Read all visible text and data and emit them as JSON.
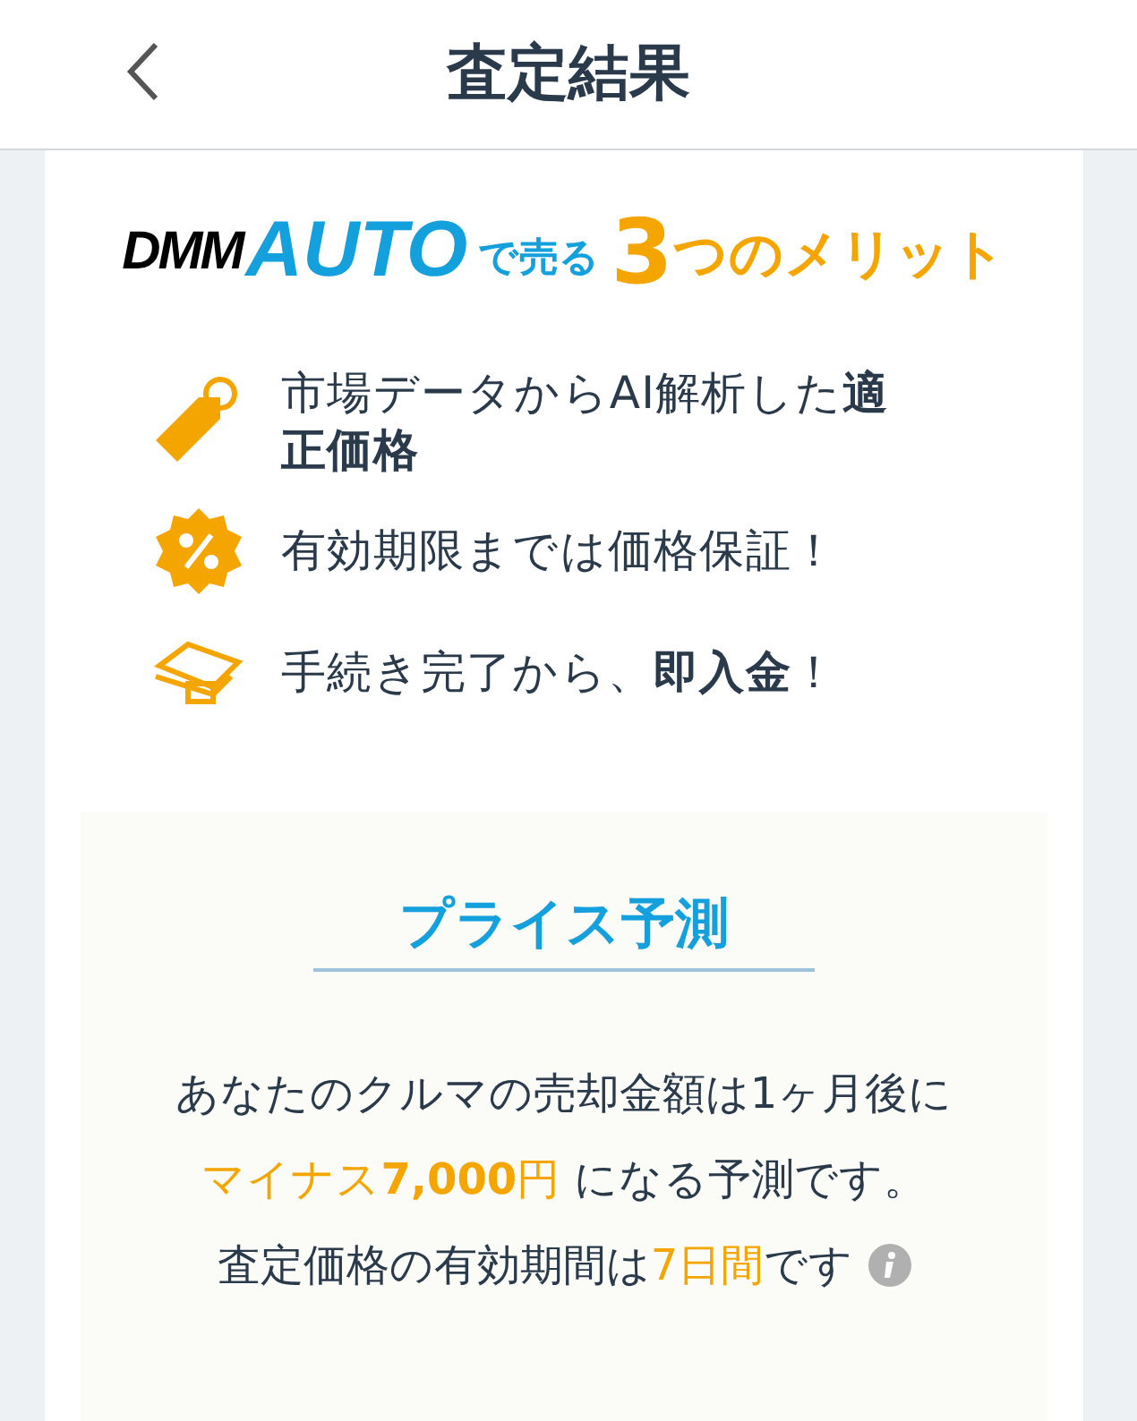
{
  "header": {
    "title": "査定結果"
  },
  "logo": {
    "brand": "DMM",
    "product": "AUTO",
    "suffix": "で売る",
    "number": "3",
    "tail": "つのメリット"
  },
  "merits": [
    {
      "kind": "tag",
      "text": "市場データからAI解析した**適正価格**"
    },
    {
      "kind": "percent",
      "text": "有効期限までは価格保証！"
    },
    {
      "kind": "money",
      "text": "手続き完了から、**即入金**！"
    }
  ],
  "prediction": {
    "title": "プライス予測",
    "lines": [
      [
        {
          "text": "あなたのクルマの売却金額は1ヶ月後に",
          "accent": false
        }
      ],
      [
        {
          "text": "マイナス**7,000**円",
          "accent": true
        },
        {
          "text": " になる予測です。",
          "accent": false
        }
      ],
      [
        {
          "text": "査定価格の有効期間は",
          "accent": false
        },
        {
          "text": "7日間",
          "accent": true
        },
        {
          "text": "です",
          "accent": false
        }
      ]
    ]
  }
}
